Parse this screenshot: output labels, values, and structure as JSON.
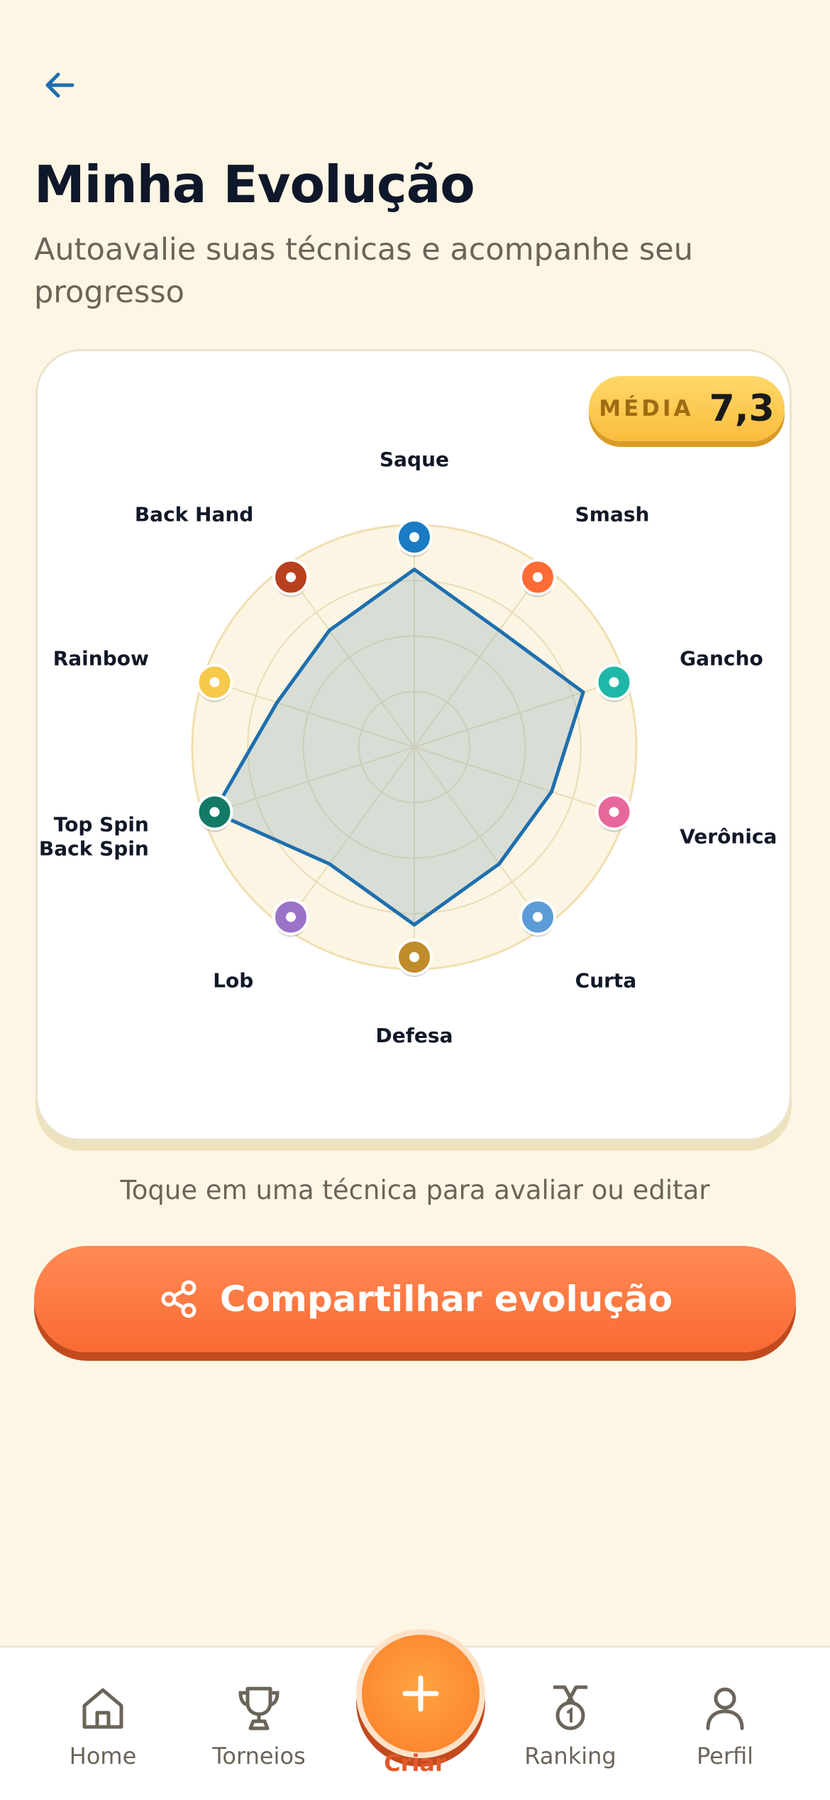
{
  "header": {
    "title": "Minha Evolução",
    "subtitle": "Autoavalie suas técnicas e acompanhe seu progresso"
  },
  "badge": {
    "label": "MÉDIA",
    "value": "7,3"
  },
  "chart_data": {
    "type": "radar",
    "max": 10,
    "axes": [
      {
        "label": "Saque",
        "value": 8.0,
        "color": "#1A7BC4"
      },
      {
        "label": "Smash",
        "value": 6.5,
        "color": "#FF6B35"
      },
      {
        "label": "Gancho",
        "value": 8.0,
        "color": "#1FB8A8"
      },
      {
        "label": "Verônica",
        "value": 6.5,
        "color": "#E8679A"
      },
      {
        "label": "Curta",
        "value": 6.5,
        "color": "#5B9BD8"
      },
      {
        "label": "Defesa",
        "value": 8.0,
        "color": "#C08C2A"
      },
      {
        "label": "Lob",
        "value": 6.5,
        "color": "#9A72C7"
      },
      {
        "label": "Top Spin\nBack Spin",
        "value": 9.5,
        "color": "#127A66"
      },
      {
        "label": "Rainbow",
        "value": 6.5,
        "color": "#F6C94A"
      },
      {
        "label": "Back Hand",
        "value": 6.5,
        "color": "#B8401F"
      }
    ],
    "series_color": "#1E6FAE"
  },
  "hint": "Toque em uma técnica para avaliar ou editar",
  "share_button": {
    "label": "Compartilhar evolução"
  },
  "nav": {
    "home": "Home",
    "tournaments": "Torneios",
    "create": "Criar",
    "ranking": "Ranking",
    "profile": "Perfil"
  }
}
